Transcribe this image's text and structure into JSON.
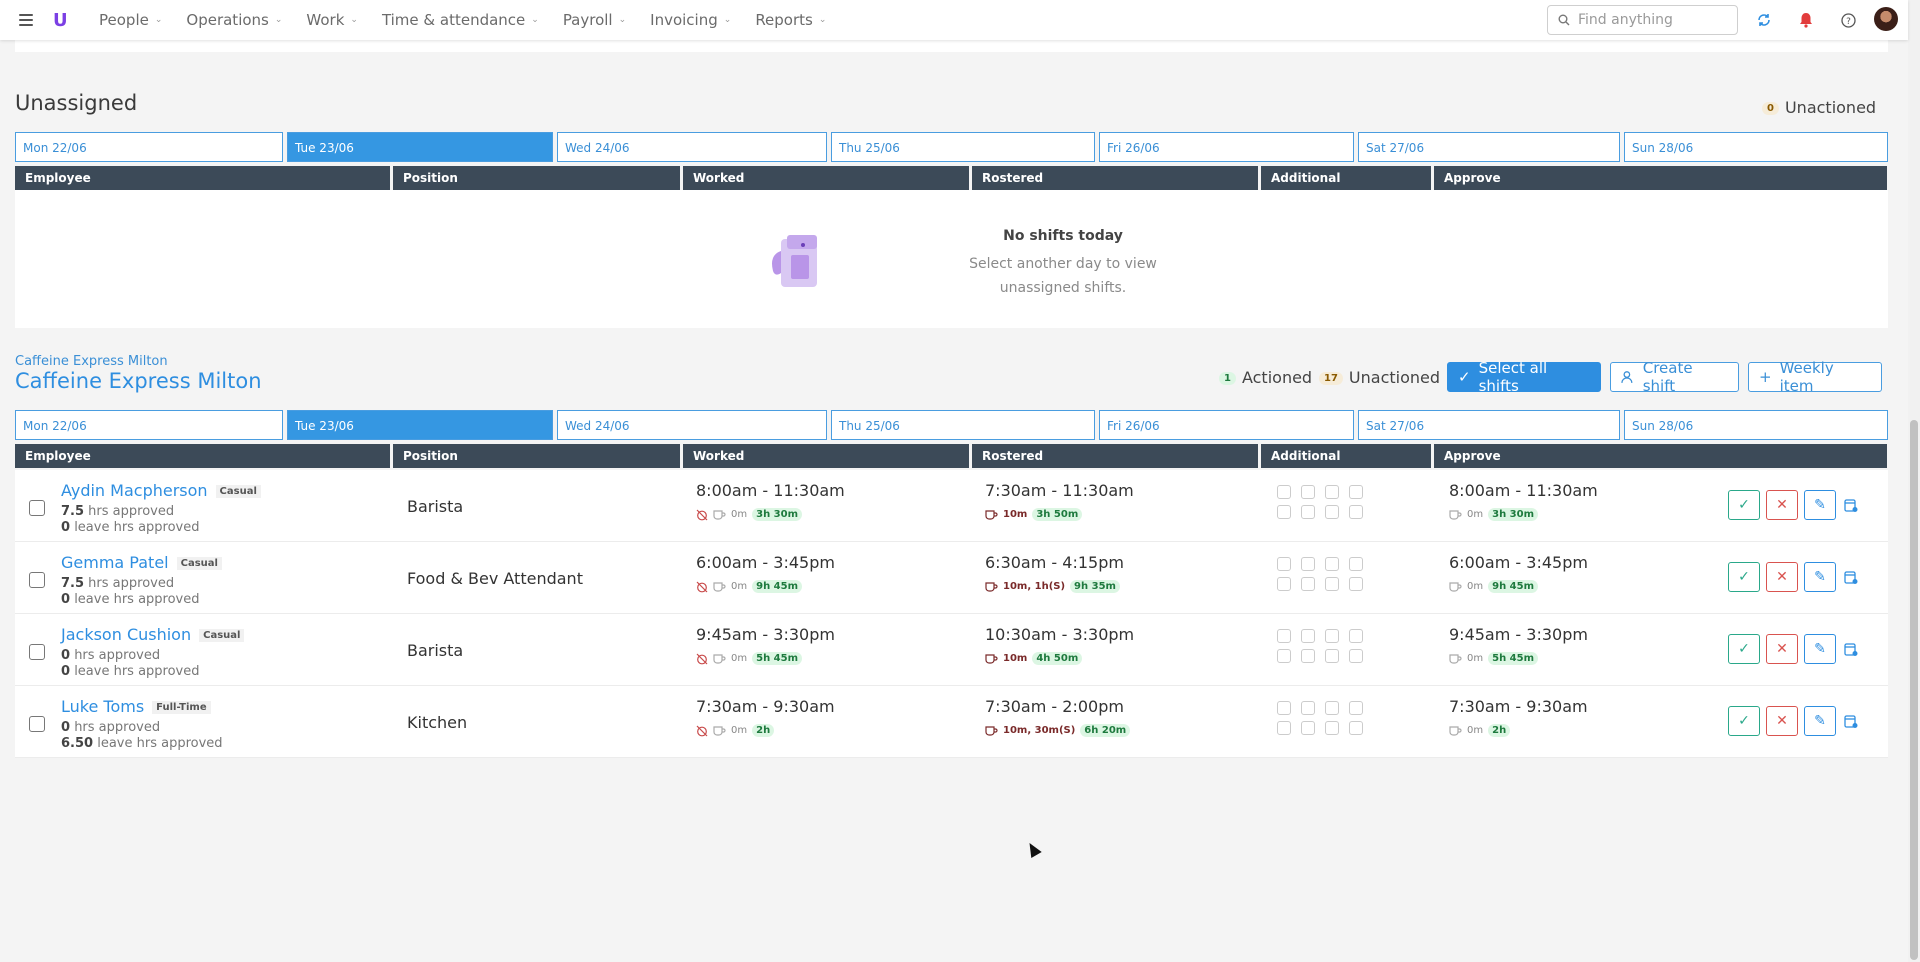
{
  "nav": {
    "menu": [
      "People",
      "Operations",
      "Work",
      "Time & attendance",
      "Payroll",
      "Invoicing",
      "Reports"
    ],
    "logo": "U",
    "search_placeholder": "Find anything"
  },
  "unassigned": {
    "title": "Unassigned",
    "unactioned_count": "0",
    "unactioned_label": "Unactioned",
    "empty_title": "No shifts today",
    "empty_text": "Select another day to view unassigned shifts."
  },
  "days": [
    "Mon 22/06",
    "Tue 23/06",
    "Wed 24/06",
    "Thu 25/06",
    "Fri 26/06",
    "Sat 27/06",
    "Sun 28/06"
  ],
  "active_day_index": 1,
  "columns": [
    "Employee",
    "Position",
    "Worked",
    "Rostered",
    "Additional",
    "Approve"
  ],
  "location": {
    "breadcrumb": "Caffeine Express Milton",
    "title": "Caffeine Express Milton",
    "actioned_count": "1",
    "actioned_label": "Actioned",
    "unactioned_count": "17",
    "unactioned_label": "Unactioned",
    "select_all_label": "Select all shifts",
    "create_shift_label": "Create shift",
    "weekly_item_label": "Weekly item"
  },
  "shifts": [
    {
      "name": "Aydin Macpherson",
      "type": "Casual",
      "hrs_approved": "7.5",
      "hrs_label": "hrs approved",
      "leave_hrs": "0",
      "leave_label": "leave hrs approved",
      "position": "Barista",
      "worked": "8:00am - 11:30am",
      "worked_break": "0m",
      "worked_total": "3h 30m",
      "rostered": "7:30am - 11:30am",
      "rostered_break": "10m",
      "rostered_total": "3h 50m",
      "approve": "8:00am - 11:30am",
      "approve_break": "0m",
      "approve_total": "3h 30m"
    },
    {
      "name": "Gemma Patel",
      "type": "Casual",
      "hrs_approved": "7.5",
      "hrs_label": "hrs approved",
      "leave_hrs": "0",
      "leave_label": "leave hrs approved",
      "position": "Food & Bev Attendant",
      "worked": "6:00am - 3:45pm",
      "worked_break": "0m",
      "worked_total": "9h 45m",
      "rostered": "6:30am - 4:15pm",
      "rostered_break": "10m, 1h(S)",
      "rostered_total": "9h 35m",
      "approve": "6:00am - 3:45pm",
      "approve_break": "0m",
      "approve_total": "9h 45m"
    },
    {
      "name": "Jackson Cushion",
      "type": "Casual",
      "hrs_approved": "0",
      "hrs_label": "hrs approved",
      "leave_hrs": "0",
      "leave_label": "leave hrs approved",
      "position": "Barista",
      "worked": "9:45am - 3:30pm",
      "worked_break": "0m",
      "worked_total": "5h 45m",
      "rostered": "10:30am - 3:30pm",
      "rostered_break": "10m",
      "rostered_total": "4h 50m",
      "approve": "9:45am - 3:30pm",
      "approve_break": "0m",
      "approve_total": "5h 45m"
    },
    {
      "name": "Luke Toms",
      "type": "Full-Time",
      "hrs_approved": "0",
      "hrs_label": "hrs approved",
      "leave_hrs": "6.50",
      "leave_label": "leave hrs approved",
      "position": "Kitchen",
      "worked": "7:30am - 9:30am",
      "worked_break": "0m",
      "worked_total": "2h",
      "rostered": "7:30am - 2:00pm",
      "rostered_break": "10m, 30m(S)",
      "rostered_total": "6h 20m",
      "approve": "7:30am - 9:30am",
      "approve_break": "0m",
      "approve_total": "2h"
    }
  ],
  "colors": {
    "accent": "#2e8ee0",
    "header_dark": "#3c4a58",
    "approve_green": "#2aa88a",
    "reject_red": "#d9534f",
    "logo_purple": "#7b3fe4"
  }
}
